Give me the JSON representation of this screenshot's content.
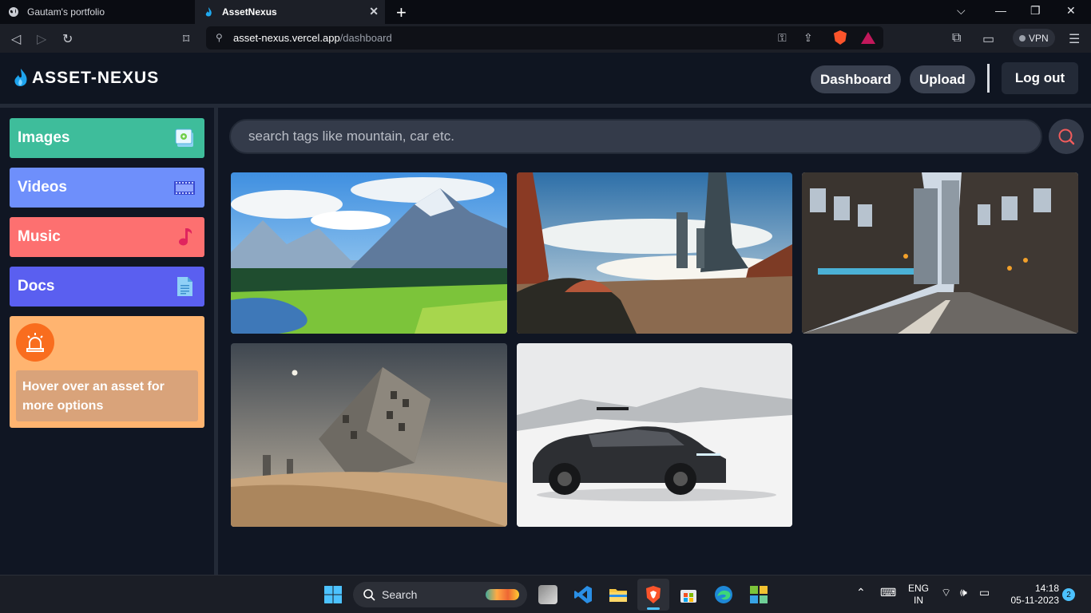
{
  "browser": {
    "tabs": [
      {
        "title": "Gautam's portfolio",
        "active": false
      },
      {
        "title": "AssetNexus",
        "active": true
      }
    ],
    "url_host": "asset-nexus.vercel.app",
    "url_path": "/dashboard",
    "vpn_label": "VPN"
  },
  "header": {
    "logo_text": "ASSET-NEXUS",
    "nav": {
      "dashboard": "Dashboard",
      "upload": "Upload",
      "logout": "Log out"
    }
  },
  "sidebar": {
    "categories": [
      {
        "label": "Images",
        "color": "#3ebd9b",
        "icon": "image-icon"
      },
      {
        "label": "Videos",
        "color": "#6e8ffb",
        "icon": "film-icon"
      },
      {
        "label": "Music",
        "color": "#fd7070",
        "icon": "music-note-icon"
      },
      {
        "label": "Docs",
        "color": "#5a5ff0",
        "icon": "document-icon"
      }
    ],
    "tip_text": "Hover over an asset for more options"
  },
  "search": {
    "placeholder": "search tags like mountain, car etc."
  },
  "gallery": [
    {
      "subject": "anime mountain valley with river"
    },
    {
      "subject": "desert canyon with futuristic towers"
    },
    {
      "subject": "city street with tall buildings"
    },
    {
      "subject": "tilted building in desert sand"
    },
    {
      "subject": "electric SUV in snowy mountains"
    }
  ],
  "taskbar": {
    "search_label": "Search",
    "language": "ENG",
    "region": "IN",
    "time": "14:18",
    "date": "05-11-2023",
    "notification_count": "2"
  }
}
